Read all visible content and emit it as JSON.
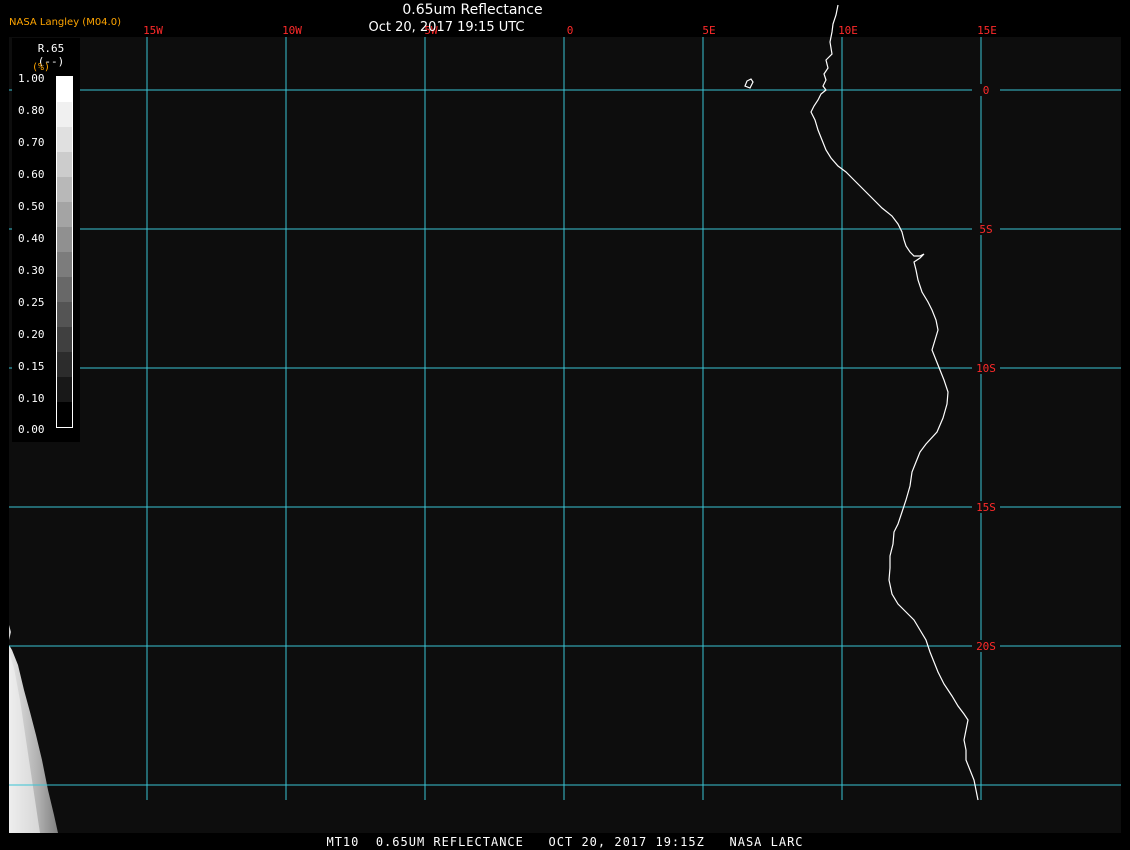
{
  "header": {
    "title": "0.65um Reflectance",
    "subtitle": "Oct 20, 2017 19:15 UTC",
    "source": "NASA Langley (M04.0)"
  },
  "footer": "MT10  0.65UM REFLECTANCE   OCT 20, 2017 19:15Z   NASA LARC",
  "legend": {
    "variable": "R.65",
    "unit": "(--)",
    "extra_mark": "(%)",
    "ticks": [
      "1.00",
      "0.80",
      "0.70",
      "0.60",
      "0.50",
      "0.40",
      "0.30",
      "0.25",
      "0.20",
      "0.15",
      "0.10",
      "0.00"
    ],
    "swatch_colors": [
      "#ffffff",
      "#f0f0f0",
      "#e0e0e0",
      "#cccccc",
      "#b8b8b8",
      "#a4a4a4",
      "#909090",
      "#7c7c7c",
      "#686868",
      "#545454",
      "#404040",
      "#2c2c2c",
      "#181818",
      "#000000"
    ]
  },
  "map": {
    "background_color": "#0d0d0d",
    "grid_color": "#39c4d4",
    "label_color": "#ff2a2a",
    "coast_color": "#ffffff",
    "lon_labels": [
      "15W",
      "10W",
      "5W",
      "0",
      "5E",
      "10E",
      "15E"
    ],
    "lat_labels": [
      "0",
      "5S",
      "10S",
      "15S",
      "20S"
    ],
    "lon_range_deg": [
      -20.0,
      15.0
    ],
    "lat_range_deg": [
      1.8,
      -25.0
    ]
  }
}
